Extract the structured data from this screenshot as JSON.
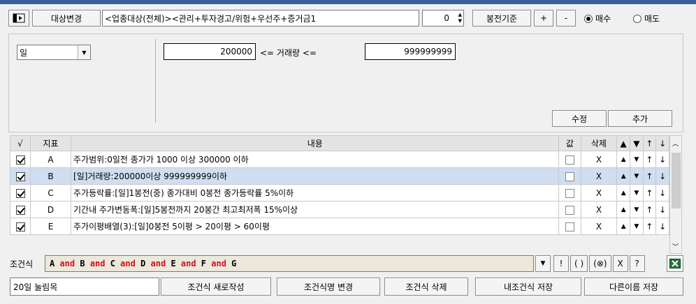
{
  "toolbar": {
    "change_target_label": "대상변경",
    "target_text": "<업종대상(전체)><관리+투자경고/위험+우선주+증거금1",
    "count_value": "0",
    "bong_label": "봉전기준",
    "plus_label": "+",
    "minus_label": "-",
    "buy_label": "매수",
    "sell_label": "매도"
  },
  "condition_panel": {
    "period_value": "일",
    "min_volume": "200000",
    "volume_operator_text": "<= 거래량 <=",
    "max_volume": "999999999",
    "edit_label": "수정",
    "add_label": "추가"
  },
  "table": {
    "headers": [
      "√",
      "지표",
      "내용",
      "값",
      "삭제",
      "▲",
      "▼",
      "↑",
      "↓"
    ],
    "rows": [
      {
        "key": "A",
        "content": "주가범위:0일전 종가가 1000 이상 300000 이하",
        "del": "X"
      },
      {
        "key": "B",
        "content": "[일]거래량:200000이상 999999999이하",
        "del": "X"
      },
      {
        "key": "C",
        "content": "주가등락률:[일]1봉전(중) 종가대비 0봉전 종가등락률 5%이하",
        "del": "X"
      },
      {
        "key": "D",
        "content": "기간내 주가변동폭:[일]5봉전까지 20봉간 최고최저폭 15%이상",
        "del": "X"
      },
      {
        "key": "E",
        "content": "주가이평배열(3):[일]0봉전 5이평 > 20이평 > 60이평",
        "del": "X"
      }
    ]
  },
  "formula_bar": {
    "label": "조건식",
    "tokens": [
      {
        "t": "A",
        "op": false
      },
      {
        "t": " and ",
        "op": true
      },
      {
        "t": "B",
        "op": false
      },
      {
        "t": " and ",
        "op": true
      },
      {
        "t": "C",
        "op": false
      },
      {
        "t": " and ",
        "op": true
      },
      {
        "t": "D",
        "op": false
      },
      {
        "t": " and ",
        "op": true
      },
      {
        "t": "E",
        "op": false
      },
      {
        "t": " and ",
        "op": true
      },
      {
        "t": "F",
        "op": false
      },
      {
        "t": " and ",
        "op": true
      },
      {
        "t": "G",
        "op": false
      }
    ],
    "buttons": [
      "!",
      "( )",
      "(⊗)",
      "X",
      "?"
    ]
  },
  "bottom": {
    "condition_name": "20일 눌림목",
    "new_label": "조건식 새로작성",
    "rename_label": "조건식명 변경",
    "delete_label": "조건식 삭제",
    "save_mine_label": "내조건식 저장",
    "save_as_label": "다른이름 저장"
  },
  "colors": {
    "title_strip": "#3a5f9a",
    "selected_row": "#cfdef0",
    "operator": "#d01020",
    "excel_green": "#1f7a3a"
  }
}
